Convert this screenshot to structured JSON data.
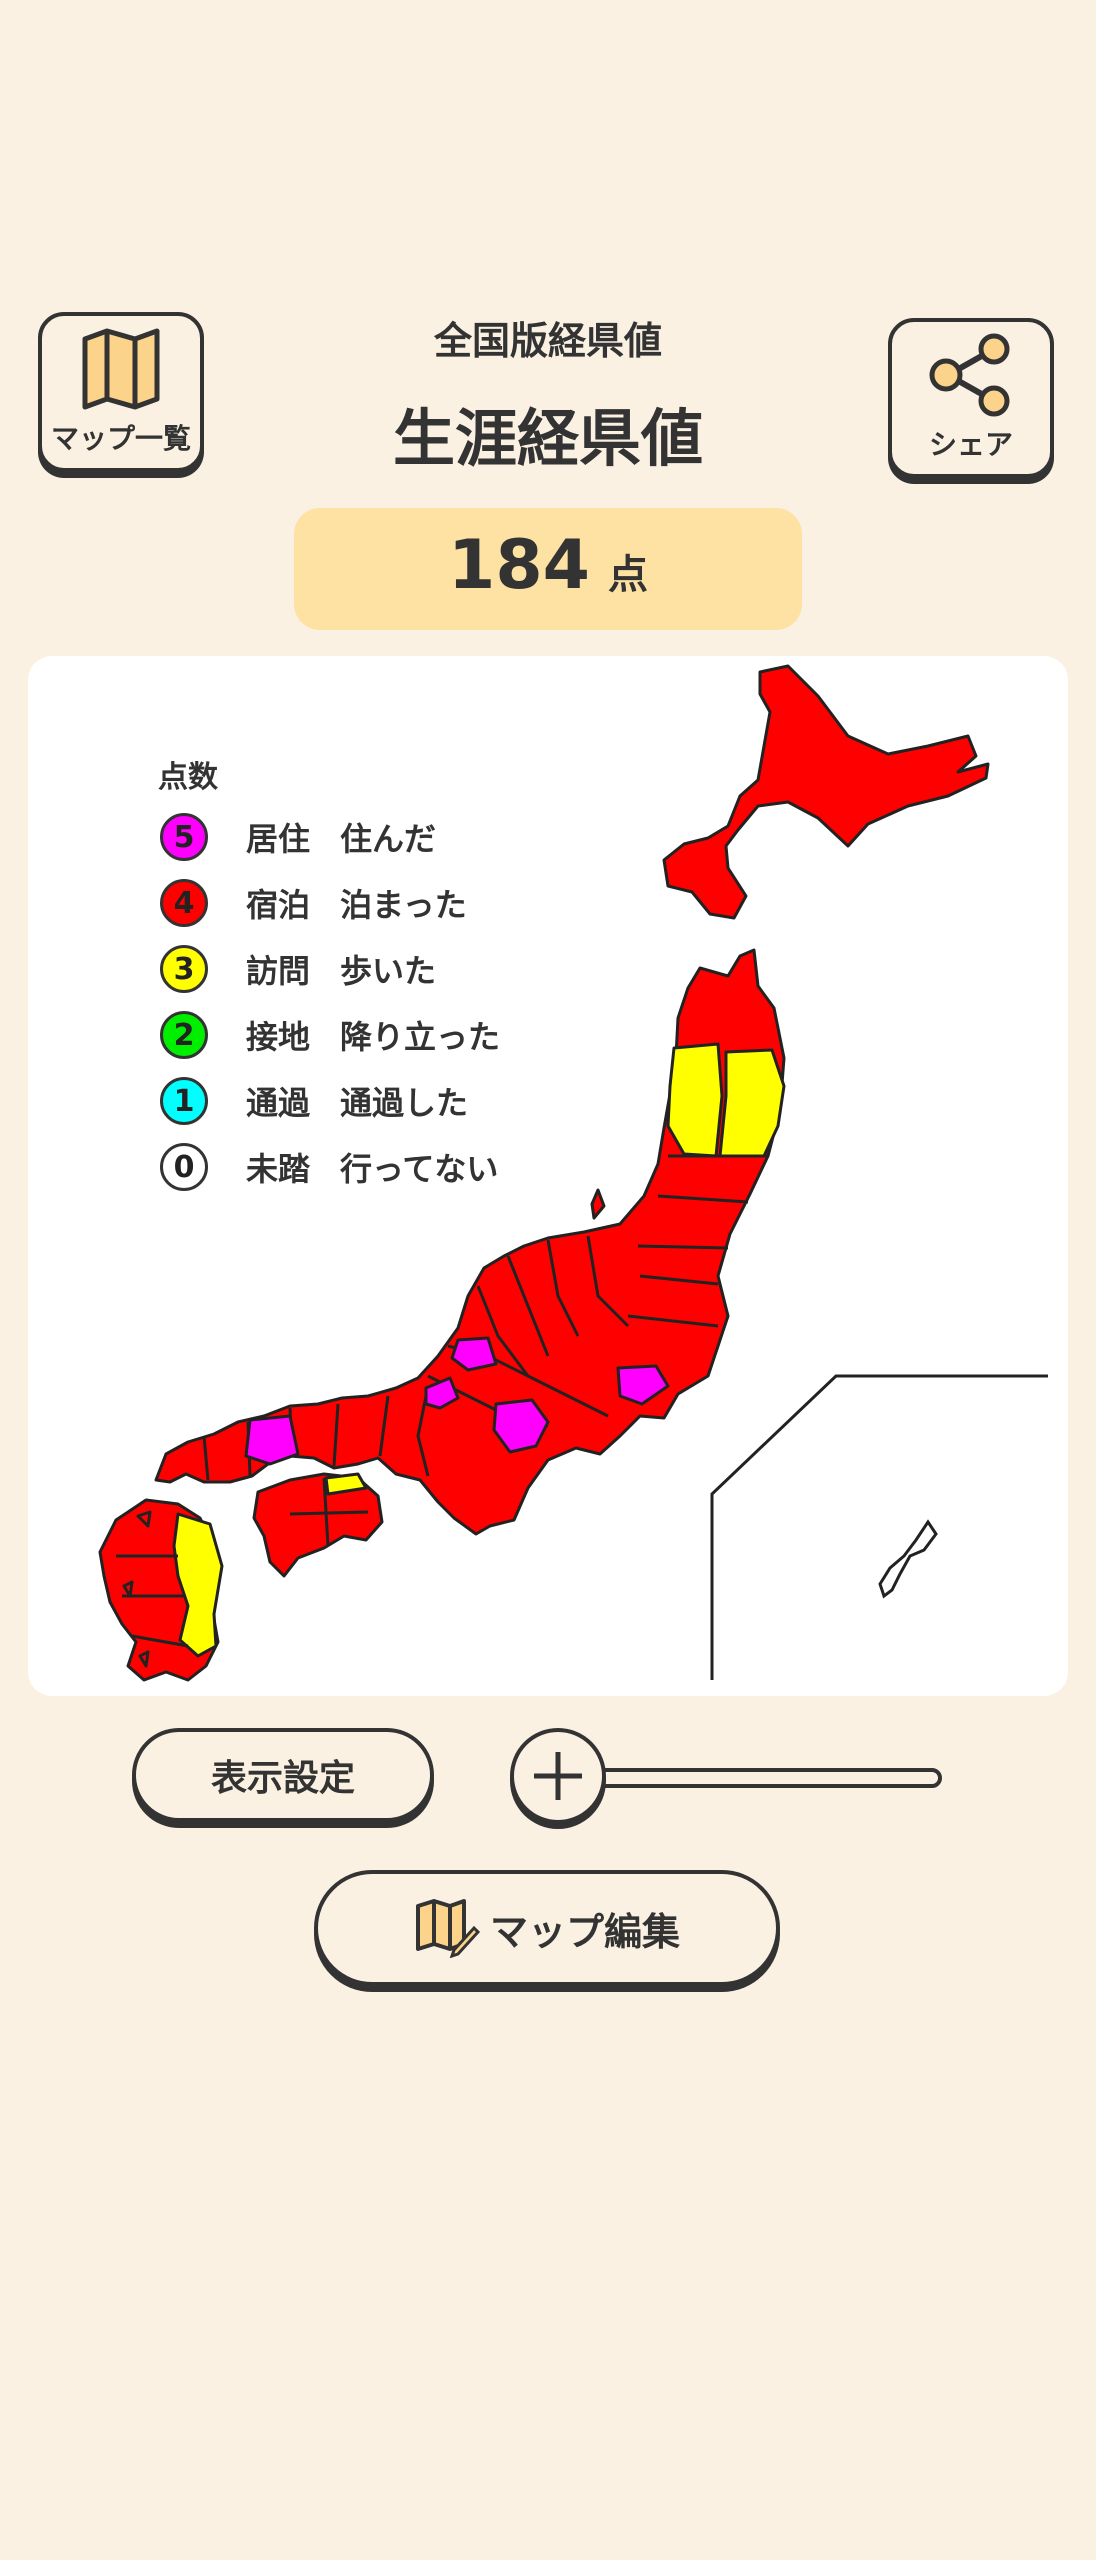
{
  "header": {
    "map_list_label": "マップ一覧",
    "share_label": "シェア",
    "subtitle": "全国版経県値",
    "title": "生涯経県値"
  },
  "score": {
    "value": "184",
    "unit": "点"
  },
  "legend": {
    "title": "点数",
    "items": [
      {
        "score": "5",
        "name": "居住",
        "desc": "住んだ",
        "color": "#ff00ff"
      },
      {
        "score": "4",
        "name": "宿泊",
        "desc": "泊まった",
        "color": "#ff0000"
      },
      {
        "score": "3",
        "name": "訪問",
        "desc": "歩いた",
        "color": "#ffff00"
      },
      {
        "score": "2",
        "name": "接地",
        "desc": "降り立った",
        "color": "#00ee00"
      },
      {
        "score": "1",
        "name": "通過",
        "desc": "通過した",
        "color": "#00ffff"
      },
      {
        "score": "0",
        "name": "未踏",
        "desc": "行ってない",
        "color": "#ffffff"
      }
    ]
  },
  "controls": {
    "display_settings_label": "表示設定",
    "zoom_icon": "plus-icon",
    "map_edit_label": "マップ編集"
  },
  "colors": {
    "background": "#faf1e3",
    "score_bg": "#fde2a3",
    "accent_icon": "#fcd38a"
  }
}
